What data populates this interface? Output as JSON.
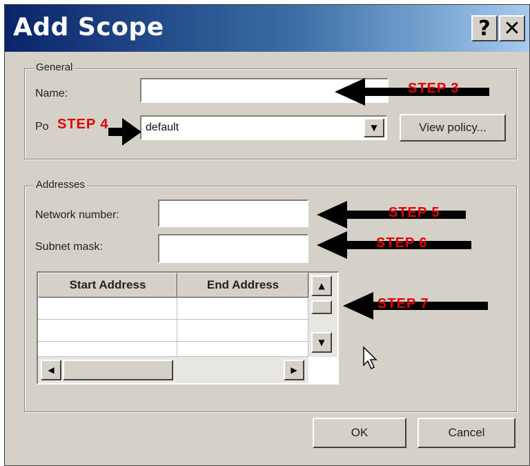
{
  "dialog": {
    "title": "Add Scope",
    "help_button": "?",
    "close_button": "✕"
  },
  "general": {
    "label": "General",
    "name_label": "Name:",
    "name_value": "",
    "policy_label": "Po",
    "policy_value": "default",
    "view_policy_button": "View policy..."
  },
  "addresses": {
    "label": "Addresses",
    "network_label": "Network number:",
    "network_value": "",
    "subnet_label": "Subnet mask:",
    "subnet_value": "",
    "table": {
      "columns": [
        "Start Address",
        "End Address"
      ],
      "rows": [
        [
          "",
          ""
        ],
        [
          "",
          ""
        ],
        [
          "",
          ""
        ]
      ]
    }
  },
  "footer": {
    "ok_button": "OK",
    "cancel_button": "Cancel"
  },
  "annotations": {
    "step3": "STEP 3",
    "step4": "STEP 4",
    "step5": "STEP 5",
    "step6": "STEP 6",
    "step7": "STEP 7"
  },
  "icons": [
    "help-icon",
    "close-icon",
    "dropdown-arrow-icon",
    "scroll-up-icon",
    "scroll-down-icon",
    "scroll-left-icon",
    "scroll-right-icon",
    "mouse-cursor-icon",
    "annotation-arrow-icon"
  ],
  "colors": {
    "titlebar_start": "#0a246a",
    "titlebar_end": "#a6caf0",
    "dialog_bg": "#d5d1c8",
    "annotation_red": "#e00000"
  }
}
